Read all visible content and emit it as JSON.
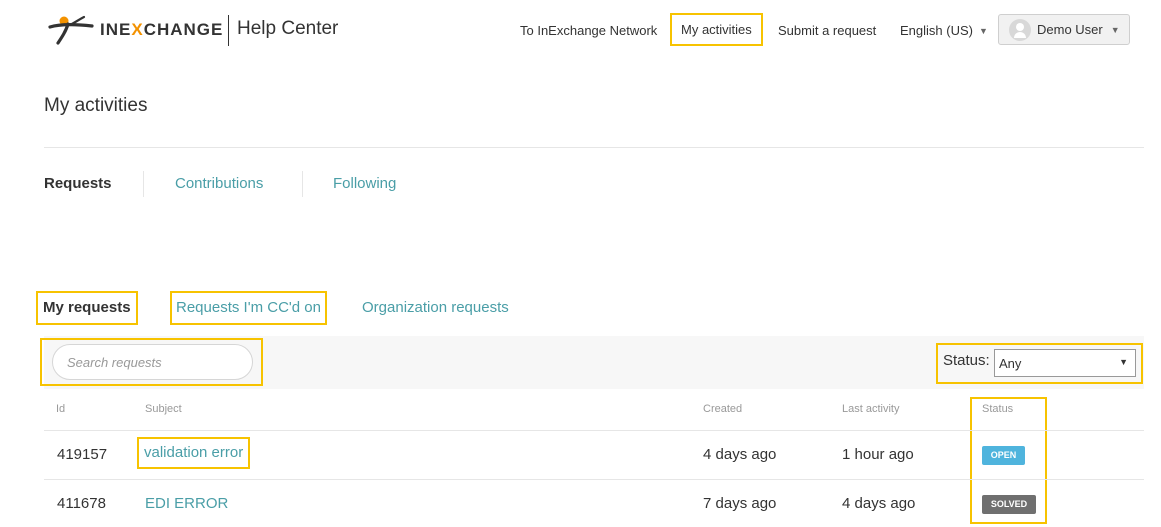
{
  "header": {
    "brand_prefix": "INE",
    "brand_x": "X",
    "brand_suffix": "CHANGE",
    "help_center": "Help Center",
    "nav": {
      "network": "To InExchange Network",
      "activities": "My activities",
      "submit": "Submit a request",
      "language": "English (US)"
    },
    "user": "Demo User"
  },
  "page": {
    "title": "My activities",
    "section_tabs": [
      "Requests",
      "Contributions",
      "Following"
    ],
    "sub_tabs": [
      "My requests",
      "Requests I'm CC'd on",
      "Organization requests"
    ]
  },
  "filters": {
    "search_placeholder": "Search requests",
    "status_label": "Status:",
    "status_value": "Any"
  },
  "table": {
    "headers": [
      "Id",
      "Subject",
      "Created",
      "Last activity",
      "Status"
    ],
    "rows": [
      {
        "id": "419157",
        "subject": "validation error",
        "created": "4 days ago",
        "last_activity": "1 hour ago",
        "status": "OPEN"
      },
      {
        "id": "411678",
        "subject": "EDI ERROR",
        "created": "7 days ago",
        "last_activity": "4 days ago",
        "status": "SOLVED"
      }
    ]
  },
  "colors": {
    "accent_link": "#4a9ea7",
    "highlight": "#f7c300",
    "open_badge": "#4fb4dd",
    "solved_badge": "#6f6f6f",
    "brand_orange": "#f39200"
  },
  "icons": [
    "inexchange-logo-icon",
    "avatar-icon",
    "caret-down-icon"
  ]
}
